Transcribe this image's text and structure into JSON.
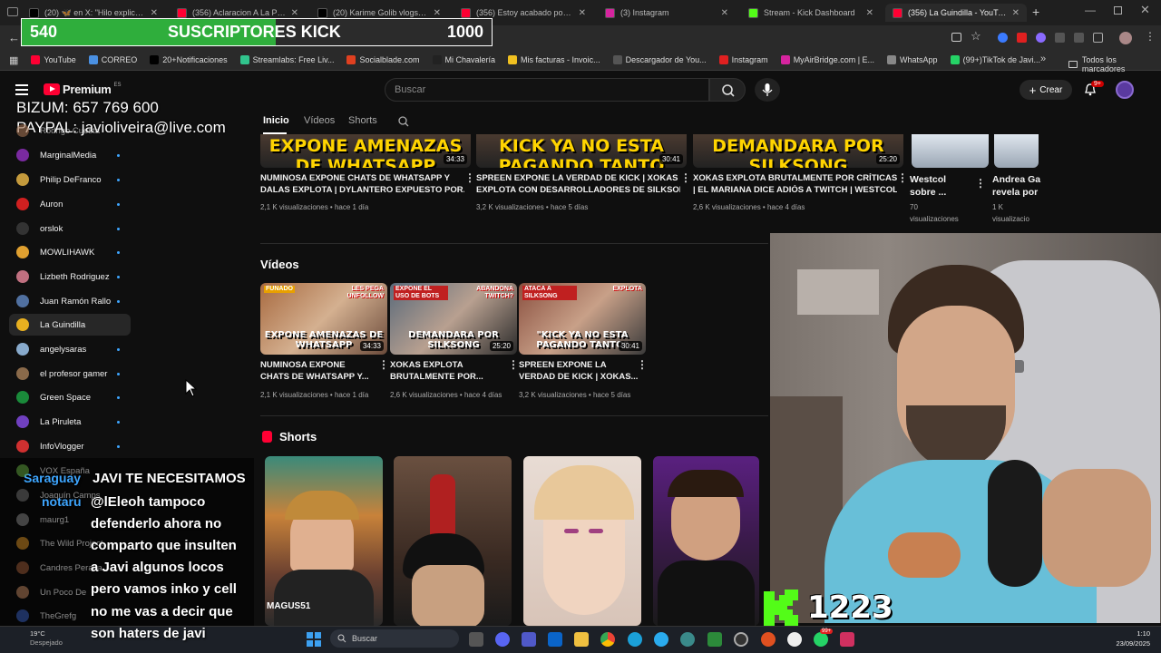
{
  "browser": {
    "tabs": [
      {
        "label": "(20) 🦋 en X: \"Hilo explicando l",
        "color": "#000"
      },
      {
        "label": "(356) Aclaracion A La Polemica",
        "color": "#ff0033"
      },
      {
        "label": "(20) Karime Golib vlogs en X: \"I",
        "color": "#000"
      },
      {
        "label": "(356) Estoy acabado por culpa",
        "color": "#ff0033"
      },
      {
        "label": "(3) Instagram",
        "color": "#d6249f"
      },
      {
        "label": "Stream - Kick Dashboard",
        "color": "#53fc18"
      },
      {
        "label": "(356) La Guindilla - YouTube",
        "color": "#ff0033"
      }
    ],
    "bookmarks": [
      "YouTube",
      "CORREO",
      "20+Notificaciones",
      "Streamlabs: Free Liv...",
      "Socialblade.com",
      "Mi Chavalería",
      "Mis facturas - Invoic...",
      "Descargador de You...",
      "Instagram",
      "MyAirBridge.com | E...",
      "WhatsApp",
      "(99+)TikTok de Javi..."
    ],
    "all_bookmarks": "Todos los marcadores"
  },
  "overlay": {
    "subs_current": "540",
    "subs_label": "SUSCRIPTORES KICK",
    "subs_goal": "1000",
    "subs_progress": 0.54,
    "bizum": "BIZUM: 657 769 600",
    "paypal": "PAYPAL: javioliveira@live.com",
    "kick_count": "1223"
  },
  "youtube": {
    "logo": "Premium",
    "logo_region": "ES",
    "search_placeholder": "Buscar",
    "create_label": "Crear",
    "notif_badge": "9+",
    "channel_tabs": [
      "Inicio",
      "Vídeos",
      "Shorts"
    ],
    "sidebar": [
      {
        "label": "Rodrigo Cuesta",
        "color": "#a07050"
      },
      {
        "label": "MarginalMedia",
        "color": "#7a2aa0"
      },
      {
        "label": "Philip DeFranco",
        "color": "#c49a3c"
      },
      {
        "label": "Auron",
        "color": "#d02020"
      },
      {
        "label": "orslok",
        "color": "#333"
      },
      {
        "label": "MOWLIHAWK",
        "color": "#e0a030"
      },
      {
        "label": "Lizbeth Rodriguez",
        "color": "#c07080"
      },
      {
        "label": "Juan Ramón Rallo",
        "color": "#5070a0"
      },
      {
        "label": "La Guindilla",
        "color": "#e8b020"
      },
      {
        "label": "angelysaras",
        "color": "#88aacc"
      },
      {
        "label": "el profesor gamer",
        "color": "#8a6a4a"
      },
      {
        "label": "Green Space",
        "color": "#1a8a3a"
      },
      {
        "label": "La Piruleta",
        "color": "#7040c0"
      },
      {
        "label": "InfoVlogger",
        "color": "#d03030"
      },
      {
        "label": "VOX España",
        "color": "#5a9a3a"
      },
      {
        "label": "Joaquín Camps",
        "color": "#666"
      },
      {
        "label": "maurg1",
        "color": "#777"
      },
      {
        "label": "The Wild Project",
        "color": "#c08020"
      },
      {
        "label": "Candres Peralta",
        "color": "#8a5030"
      },
      {
        "label": "Un Poco De",
        "color": "#aa7755"
      },
      {
        "label": "TheGrefg",
        "color": "#3355aa"
      }
    ],
    "top_row": [
      {
        "cap": "EXPONE AMENAZAS DE WHATSAPP",
        "dur": "34:33",
        "title1": "NUMINOSA EXPONE CHATS DE WHATSAPP Y",
        "title2": "DALAS EXPLOTA | DYLANTERO EXPUESTO POR...",
        "meta": "2,1 K visualizaciones • hace 1 día"
      },
      {
        "cap": "KICK YA NO ESTA PAGANDO TANTO",
        "dur": "30:41",
        "title1": "SPREEN EXPONE LA VERDAD DE KICK | XOKAS",
        "title2": "EXPLOTA CON DESARROLLADORES DE SILKSONG ...",
        "meta": "3,2 K visualizaciones • hace 5 días"
      },
      {
        "cap": "DEMANDARA POR SILKSONG",
        "dur": "25:20",
        "title1": "XOKAS EXPLOTA BRUTALMENTE POR CRÍTICAS",
        "title2": "| EL MARIANA DICE ADIÓS A TWITCH | WESTCOL...",
        "meta": "2,6 K visualizaciones • hace 4 días"
      }
    ],
    "top_shorts": [
      {
        "title1": "Westcol",
        "title2": "sobre ...",
        "meta1": "70",
        "meta2": "visualizaciones"
      },
      {
        "title1": "Andrea Ga",
        "title2": "revela por",
        "meta1": "1 K",
        "meta2": "visualizacio"
      }
    ],
    "videos_section": "Vídeos",
    "videos": [
      {
        "tag": "FUNADO",
        "tag2": "LES PEGA UNFOLLOW",
        "cap": "EXPONE AMENAZAS DE WHATSAPP",
        "dur": "34:33",
        "title1": "NUMINOSA EXPONE",
        "title2": "CHATS DE WHATSAPP Y...",
        "meta": "2,1 K visualizaciones • hace 1 día"
      },
      {
        "tag": "EXPONE EL USO DE BOTS",
        "tag2": "ABANDONA TWITCH?",
        "cap": "DEMANDARA POR SILKSONG",
        "dur": "25:20",
        "title1": "XOKAS EXPLOTA",
        "title2": "BRUTALMENTE POR...",
        "meta": "2,6 K visualizaciones • hace 4 días"
      },
      {
        "tag": "ATACA A SILKSONG",
        "tag2": "EXPLOTA",
        "cap": "\"KICK YA NO ESTA PAGANDO TANTO\"",
        "dur": "30:41",
        "title1": "SPREEN EXPONE LA",
        "title2": "VERDAD DE KICK | XOKAS...",
        "meta": "3,2 K visualizaciones • hace 5 días"
      }
    ],
    "shorts_section": "Shorts",
    "shorts_label": "MAGUS51"
  },
  "chat": {
    "line1_user": "Saraguay",
    "line1_msg": "JAVI TE NECESITAMOS",
    "line2_user": "notaru",
    "lines": [
      "@lEleoh tampoco",
      "defenderlo ahora no",
      "comparto que insulten",
      "a Javi algunos locos",
      "pero vamos inko y cell",
      "no me vas a decir que",
      "son haters de javi"
    ]
  },
  "taskbar": {
    "weather_temp": "19°C",
    "weather_desc": "Despejado",
    "search": "Buscar",
    "time": "1:10",
    "date": "23/09/2025",
    "badge": "99+"
  },
  "colors": {
    "kick_green": "#53fc18",
    "youtube_red": "#ff0033",
    "bar_green": "#2fae3c",
    "link_blue": "#3ea6ff"
  }
}
